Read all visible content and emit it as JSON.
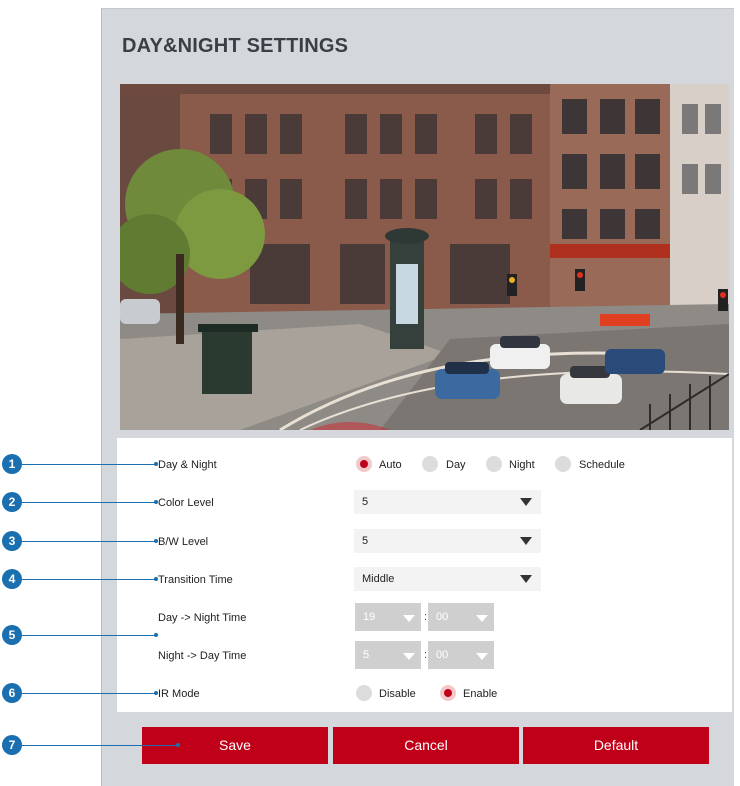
{
  "page": {
    "title": "DAY&NIGHT SETTINGS"
  },
  "fields": {
    "day_night": {
      "label": "Day & Night",
      "options": [
        "Auto",
        "Day",
        "Night",
        "Schedule"
      ],
      "selected": "Auto"
    },
    "color_level": {
      "label": "Color Level",
      "value": "5"
    },
    "bw_level": {
      "label": "B/W Level",
      "value": "5"
    },
    "transition_time": {
      "label": "Transition Time",
      "value": "Middle"
    },
    "day_to_night": {
      "label": "Day -> Night Time",
      "hour": "19",
      "minute": "00"
    },
    "night_to_day": {
      "label": "Night -> Day Time",
      "hour": "5",
      "minute": "00"
    },
    "time_separator": ":",
    "ir_mode": {
      "label": "IR Mode",
      "options": [
        "Disable",
        "Enable"
      ],
      "selected": "Enable"
    }
  },
  "buttons": {
    "save": "Save",
    "cancel": "Cancel",
    "default": "Default"
  },
  "callouts": [
    "1",
    "2",
    "3",
    "4",
    "5",
    "6",
    "7"
  ],
  "colors": {
    "accent": "#c00018",
    "callout": "#1a6fb0",
    "panel": "#d4d7dc"
  },
  "icons": {
    "dropdown": "triangle-down"
  }
}
